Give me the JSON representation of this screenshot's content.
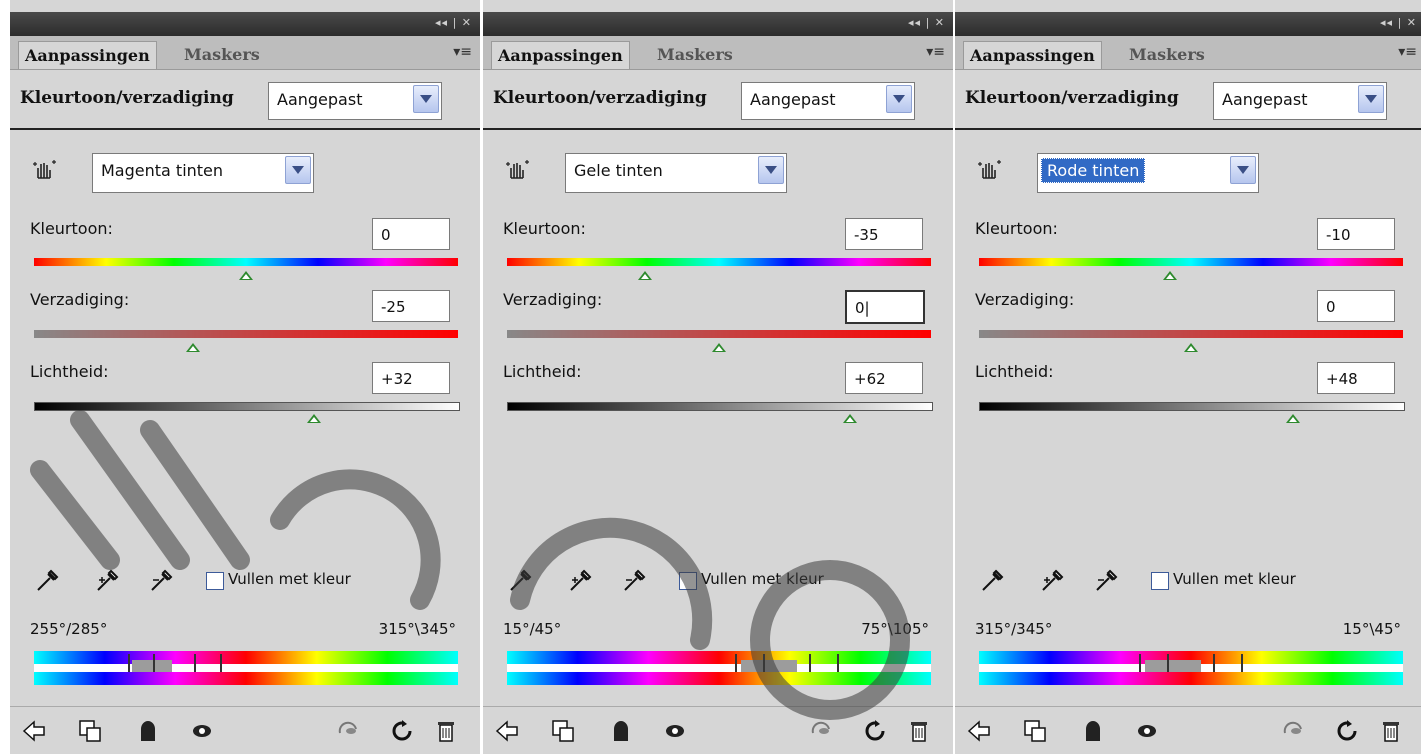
{
  "panels": [
    {
      "tabs": [
        "Aanpassingen",
        "Maskers"
      ],
      "title": "Kleurtoon/verzadiging",
      "preset": "Aangepast",
      "range": "Magenta tinten",
      "hue_label": "Kleurtoon:",
      "hue_value": "0",
      "hue_fraction": 0.5,
      "sat_label": "Verzadiging:",
      "sat_value": "-25",
      "sat_fraction": 0.375,
      "light_label": "Lichtheid:",
      "light_value": "+32",
      "light_fraction": 0.66,
      "colorize_label": "Vullen met kleur",
      "range_left": "255°/285°",
      "range_right": "315°\\345°",
      "spectrum_colors": [
        "#00ffff",
        "#0000ff",
        "#ff00ff",
        "#ff0000",
        "#ffff00",
        "#00ff00",
        "#00ffff"
      ],
      "range_selected": false
    },
    {
      "tabs": [
        "Aanpassingen",
        "Maskers"
      ],
      "title": "Kleurtoon/verzadiging",
      "preset": "Aangepast",
      "range": "Gele tinten",
      "hue_label": "Kleurtoon:",
      "hue_value": "-35",
      "hue_fraction": 0.325,
      "sat_label": "Verzadiging:",
      "sat_value": "0|",
      "sat_fraction": 0.5,
      "light_label": "Lichtheid:",
      "light_value": "+62",
      "light_fraction": 0.81,
      "colorize_label": "Vullen met kleur",
      "range_left": "15°/45°",
      "range_right": "75°\\105°",
      "spectrum_colors": [
        "#00ffff",
        "#0000ff",
        "#ff00ff",
        "#ff0000",
        "#ffff00",
        "#00ff00",
        "#00ffff"
      ],
      "range_selected": false
    },
    {
      "tabs": [
        "Aanpassingen",
        "Maskers"
      ],
      "title": "Kleurtoon/verzadiging",
      "preset": "Aangepast",
      "range": "Rode tinten",
      "hue_label": "Kleurtoon:",
      "hue_value": "-10",
      "hue_fraction": 0.45,
      "sat_label": "Verzadiging:",
      "sat_value": "0",
      "sat_fraction": 0.5,
      "light_label": "Lichtheid:",
      "light_value": "+48",
      "light_fraction": 0.74,
      "colorize_label": "Vullen met kleur",
      "range_left": "315°/345°",
      "range_right": "15°\\45°",
      "spectrum_colors": [
        "#00ffff",
        "#0000ff",
        "#ff00ff",
        "#ff0000",
        "#ffff00",
        "#00ff00",
        "#00ffff"
      ],
      "range_selected": true
    }
  ],
  "titlebar_controls": "◂◂ | ✕",
  "menu_icon": "▾≡"
}
